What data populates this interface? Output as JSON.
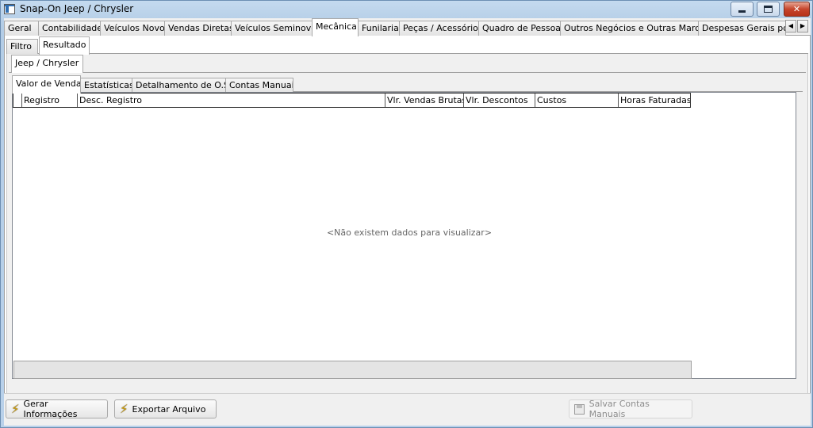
{
  "window": {
    "title": "Snap-On Jeep / Chrysler",
    "controls": {
      "minimize": "minimize",
      "maximize": "maximize",
      "close": "✕"
    }
  },
  "main_tabs": [
    "Geral",
    "Contabilidade",
    "Veículos Novos",
    "Vendas Diretas",
    "Veículos Seminovos",
    "Mecânica",
    "Funilaria",
    "Peças / Acessórios",
    "Quadro de Pessoas",
    "Outros Negócios e Outras Marcas",
    "Despesas Gerais por De"
  ],
  "main_tabs_active": "Mecânica",
  "sub_tabs": [
    "Filtro",
    "Resultado"
  ],
  "sub_tabs_active": "Resultado",
  "brand_tab": "Jeep / Chrysler",
  "inner_tabs": [
    "Valor de Vendas",
    "Estatísticas",
    "Detalhamento de O.S.",
    "Contas Manuais"
  ],
  "inner_tabs_active": "Valor de Vendas",
  "grid": {
    "columns": [
      "Registro",
      "Desc. Registro",
      "Vlr. Vendas Brutas",
      "Vlr. Descontos",
      "Custos",
      "Horas Faturadas"
    ],
    "empty_message": "<Não existem dados para visualizar>"
  },
  "footer_buttons": {
    "generate": "Gerar Informações",
    "export": "Exportar Arquivo",
    "save": "Salvar Contas Manuais"
  },
  "icons": {
    "generate": "lightning-icon",
    "export": "lightning-icon",
    "save": "floppy-disk-icon"
  },
  "colors": {
    "titlebar": "#c4daef",
    "close_button": "#c6452c",
    "lightning": "#d4a20a"
  }
}
